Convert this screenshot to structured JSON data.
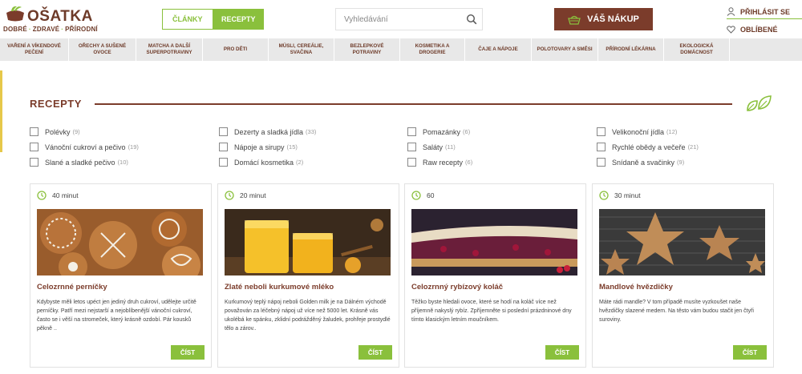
{
  "logo": {
    "title": "OŠATKA",
    "sub1": "DOBRÉ",
    "sub2": "ZDRAVÉ",
    "sub3": "PŘÍRODNÍ"
  },
  "toggle": {
    "clanky": "ČLÁNKY",
    "recepty": "RECEPTY"
  },
  "search": {
    "placeholder": "Vyhledávání"
  },
  "cart": {
    "label": "VÁŠ NÁKUP"
  },
  "user": {
    "login": "PŘIHLÁSIT SE",
    "favorites": "OBLÍBENÉ"
  },
  "nav": [
    "VAŘENÍ A VÍKENDOVÉ PEČENÍ",
    "OŘECHY A SUŠENÉ OVOCE",
    "MATCHA A DALŠÍ SUPERPOTRAVINY",
    "PRO DĚTI",
    "MÜSLI, CEREÁLIE, SVAČINA",
    "BEZLEPKOVÉ POTRAVINY",
    "KOSMETIKA A DROGERIE",
    "ČAJE A NÁPOJE",
    "POLOTOVARY A SMĚSI",
    "PŘÍRODNÍ LÉKÁRNA",
    "EKOLOGICKÁ DOMÁCNOST"
  ],
  "section": {
    "title": "RECEPTY"
  },
  "filters": [
    [
      {
        "label": "Polévky",
        "count": "(9)"
      },
      {
        "label": "Vánoční cukroví a pečivo",
        "count": "(19)"
      },
      {
        "label": "Slané a sladké pečivo",
        "count": "(10)"
      }
    ],
    [
      {
        "label": "Dezerty a sladká jídla",
        "count": "(33)"
      },
      {
        "label": "Nápoje a sirupy",
        "count": "(15)"
      },
      {
        "label": "Domácí kosmetika",
        "count": "(2)"
      }
    ],
    [
      {
        "label": "Pomazánky",
        "count": "(6)"
      },
      {
        "label": "Saláty",
        "count": "(11)"
      },
      {
        "label": "Raw recepty",
        "count": "(6)"
      }
    ],
    [
      {
        "label": "Velikonoční jídla",
        "count": "(12)"
      },
      {
        "label": "Rychlé obědy a večeře",
        "count": "(21)"
      },
      {
        "label": "Snídaně a svačinky",
        "count": "(9)"
      }
    ]
  ],
  "cards": [
    {
      "time": "40 minut",
      "title": "Celozrnné perníčky",
      "text": "Kdybyste měli letos upéct jen jediný druh cukroví, udělejte určitě perníčky. Patří mezi nejstarší a nejoblíbenější vánoční cukroví, často se i věší na stromeček, který krásně ozdobí. Pár kousků pěkně ..",
      "button": "ČÍST"
    },
    {
      "time": "20 minut",
      "title": "Zlaté neboli kurkumové mléko",
      "text": "Kurkumový teplý nápoj neboli Golden milk je na Dálném východě považován za léčebný nápoj už více než 5000 let. Krásně vás ukolébá ke spánku, zklidní podrážděný žaludek, prohřeje prostydlé tělo a zárov..",
      "button": "ČÍST"
    },
    {
      "time": "60",
      "title": "Celozrnný rybízový koláč",
      "text": "Těžko byste hledali ovoce, které se hodí na koláč více než příjemně nakyslý rybíz. Zpříjemněte si poslední prázdninové dny tímto klasickým letním moučníkem.",
      "button": "ČÍST"
    },
    {
      "time": "30 minut",
      "title": "Mandlové hvězdičky",
      "text": "Máte rádi mandle? V tom případě musíte vyzkoušet naše hvězdičky slazené medem. Na těsto vám budou stačit jen čtyři suroviny.",
      "button": "ČÍST"
    }
  ],
  "colors": {
    "brand": "#7b3c2b",
    "accent": "#8ac03c",
    "nav_bg": "#e8e8e8"
  }
}
